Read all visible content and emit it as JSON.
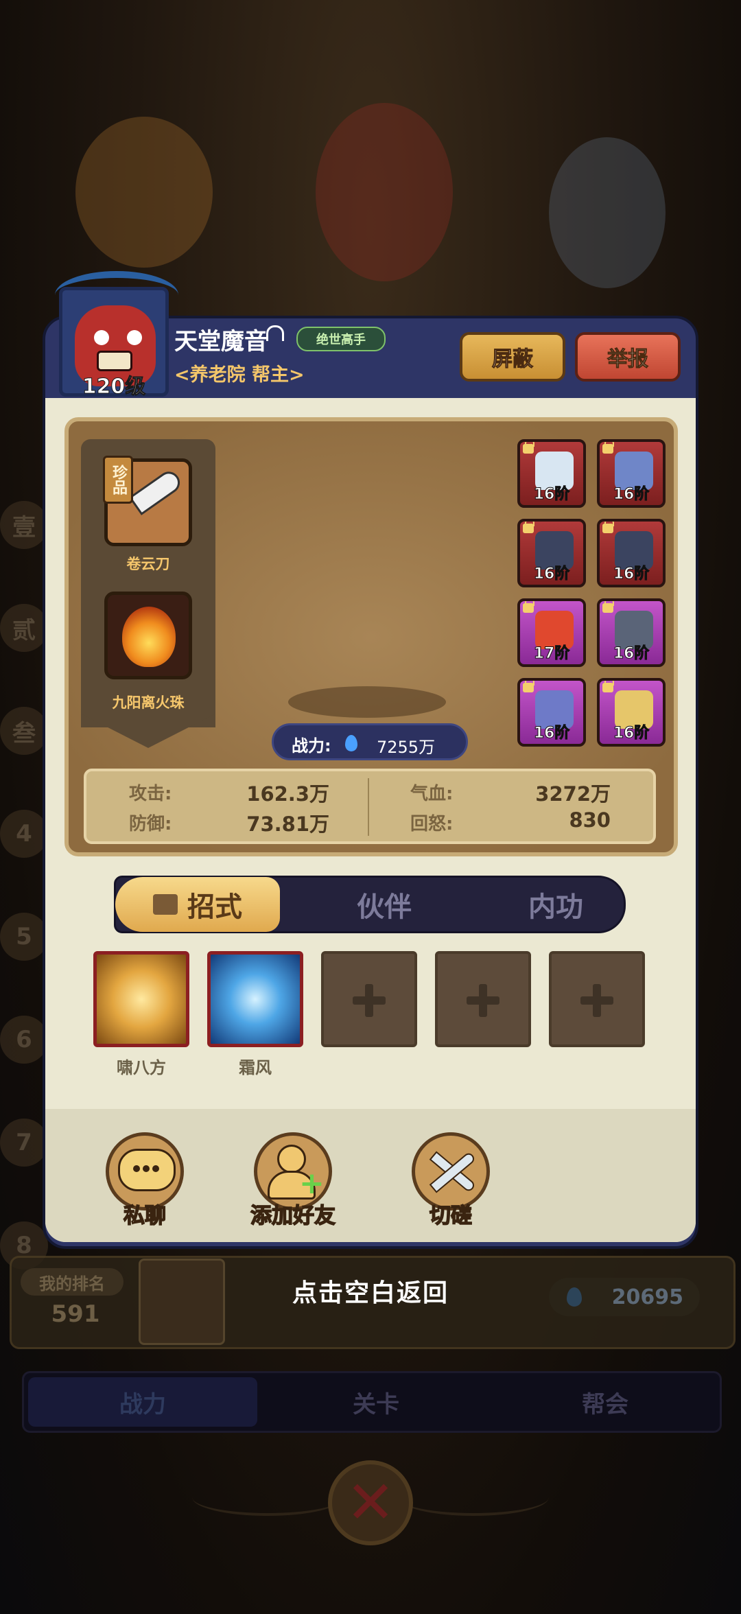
{
  "player": {
    "name": "天堂魔音",
    "title_badge": "绝世高手",
    "guild": "<养老院 帮主>",
    "level": "120级"
  },
  "buttons": {
    "block": "屏蔽",
    "report": "举报"
  },
  "treasures": [
    {
      "name": "卷云刀",
      "tag": "珍品"
    },
    {
      "name": "九阳离火珠"
    }
  ],
  "equipment": [
    {
      "tier": "16阶",
      "color": "red",
      "locked": true
    },
    {
      "tier": "16阶",
      "color": "red",
      "locked": true
    },
    {
      "tier": "16阶",
      "color": "red",
      "locked": true
    },
    {
      "tier": "16阶",
      "color": "red",
      "locked": true
    },
    {
      "tier": "17阶",
      "color": "purple",
      "locked": true
    },
    {
      "tier": "16阶",
      "color": "purple",
      "locked": true
    },
    {
      "tier": "16阶",
      "color": "purple",
      "locked": true
    },
    {
      "tier": "16阶",
      "color": "purple",
      "locked": true
    }
  ],
  "power": {
    "label": "战力:",
    "value": "7255万"
  },
  "stats": {
    "attack_label": "攻击:",
    "attack": "162.3万",
    "defense_label": "防御:",
    "defense": "73.81万",
    "hp_label": "气血:",
    "hp": "3272万",
    "rage_label": "回怒:",
    "rage": "830"
  },
  "tabs": {
    "moves": "招式",
    "partners": "伙伴",
    "internal": "内功",
    "active": "招式"
  },
  "skills": [
    {
      "name": "啸八方"
    },
    {
      "name": "霜风"
    }
  ],
  "actions": {
    "chat": "私聊",
    "add_friend": "添加好友",
    "spar": "切磋"
  },
  "hint": "点击空白返回",
  "background": {
    "my_rank_label": "我的排名",
    "my_rank": "591",
    "rank_power": "20695",
    "bottom_tabs": [
      "战力",
      "关卡",
      "帮会"
    ],
    "side_numbers": [
      "壹",
      "贰",
      "叁",
      "4",
      "5",
      "6",
      "7",
      "8"
    ]
  },
  "colors": {
    "panel_header": "#2e3566",
    "panel_body": "#ebe8d2",
    "gold": "#e0a94e",
    "red_button": "#c04632",
    "equip_red": "#b13a3a",
    "equip_purple": "#c355c9"
  }
}
